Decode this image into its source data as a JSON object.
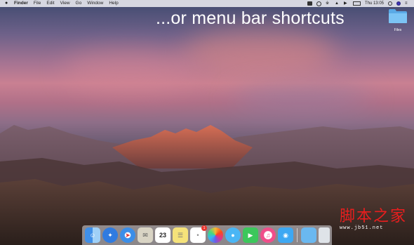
{
  "menubar": {
    "app_name": "Finder",
    "items": [
      "File",
      "Edit",
      "View",
      "Go",
      "Window",
      "Help"
    ],
    "clock": "Thu 13:05"
  },
  "headline": "...or menu bar shortcuts",
  "desktop": {
    "folder_label": "Files"
  },
  "dock": {
    "calendar_date": "23",
    "reminders_badge": "1",
    "apps": [
      "finder-icon",
      "launchpad-icon",
      "safari-icon",
      "mail-icon",
      "calendar-icon",
      "notes-icon",
      "reminders-icon",
      "photos-icon",
      "messages-icon",
      "facetime-icon",
      "itunes-icon",
      "tweetbot-icon",
      "folder-icon",
      "trash-icon"
    ]
  },
  "watermark": {
    "title": "脚本之家",
    "url": "www.jb51.net"
  },
  "colors": {
    "menubar": "#ebebf0",
    "badge": "#e8352e",
    "watermark": "#e81e1e"
  }
}
